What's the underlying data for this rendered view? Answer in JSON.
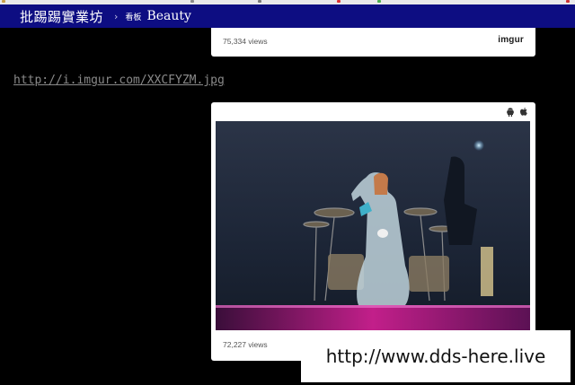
{
  "header": {
    "board_name": "批踢踢實業坊",
    "separator": "›",
    "board_prefix": "看板",
    "board_title": "Beauty"
  },
  "top_embed": {
    "views": "75,334 views",
    "logo": "imgur"
  },
  "post": {
    "image_link": "http://i.imgur.com/XXCFYZM.jpg"
  },
  "main_embed": {
    "platform_icons": [
      "android-icon",
      "apple-icon"
    ],
    "photo_description": "concert stage photo",
    "views": "72,227 views"
  },
  "watermark": {
    "text": "http://www.dds-here.live"
  },
  "colors": {
    "header_bg": "#0d0d82",
    "page_bg": "#000000",
    "link": "#8a8a8a"
  }
}
